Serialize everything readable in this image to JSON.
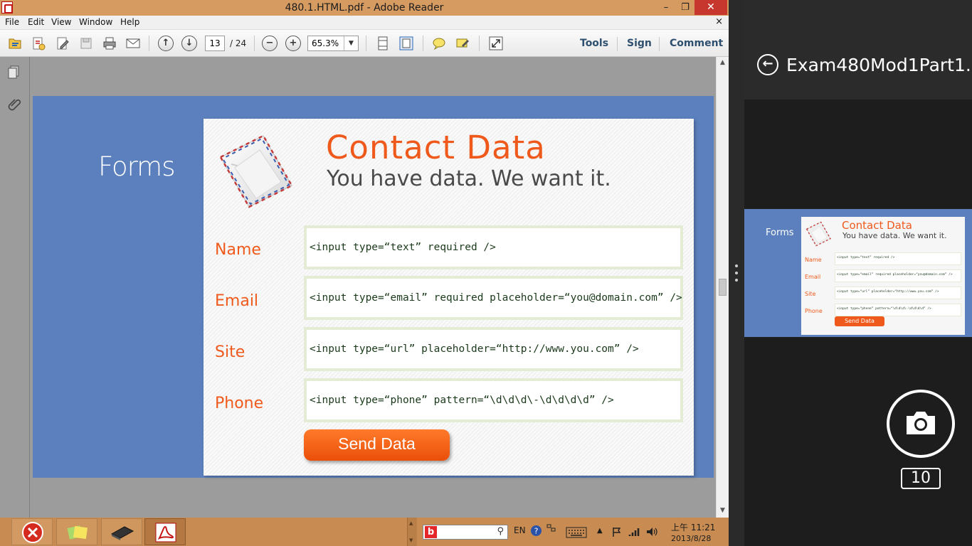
{
  "window": {
    "title": "480.1.HTML.pdf - Adobe Reader",
    "minimize": "–",
    "maximize": "❐",
    "close": "✕"
  },
  "menu": {
    "items": [
      "File",
      "Edit",
      "View",
      "Window",
      "Help"
    ],
    "doc_close": "×"
  },
  "toolbar": {
    "page_current": "13",
    "page_total": "/ 24",
    "zoom": "65.3%",
    "tools_label": "Tools",
    "sign_label": "Sign",
    "comment_label": "Comment"
  },
  "slide": {
    "section_label": "Forms",
    "title": "Contact Data",
    "subtitle": "You have data. We want it.",
    "fields": [
      {
        "label": "Name",
        "code": "<input type=“text” required />"
      },
      {
        "label": "Email",
        "code": "<input type=“email” required placeholder=“you@domain.com” />"
      },
      {
        "label": "Site",
        "code": "<input type=“url” placeholder=“http://www.you.com” />"
      },
      {
        "label": "Phone",
        "code": "<input type=“phone” pattern=“\\d\\d\\d\\-\\d\\d\\d\\d” />"
      }
    ],
    "send_label": "Send Data"
  },
  "taskbar": {
    "tray_lang": "EN",
    "clock_time": "上午 11:21",
    "clock_date": "2013/8/28"
  },
  "side_panel": {
    "title": "Exam480Mod1Part1...",
    "thumbnail": {
      "section_label": "Forms",
      "title": "Contact Data",
      "subtitle": "You have data. We want it.",
      "fields": [
        {
          "label": "Name",
          "code": "<input type=“text” required />"
        },
        {
          "label": "Email",
          "code": "<input type=“email” required placeholder=“you@domain.com” />"
        },
        {
          "label": "Site",
          "code": "<input type=“url” placeholder=“http://www.you.com” />"
        },
        {
          "label": "Phone",
          "code": "<input type=“phone” pattern=“\\d\\d\\d\\-\\d\\d\\d\\d” />"
        }
      ],
      "send_label": "Send Data"
    },
    "count": "10"
  },
  "colors": {
    "accent_orange": "#ef5a1c",
    "slide_blue": "#5b80bd",
    "titlebar": "#d69b61",
    "taskbar": "#c88c52"
  }
}
